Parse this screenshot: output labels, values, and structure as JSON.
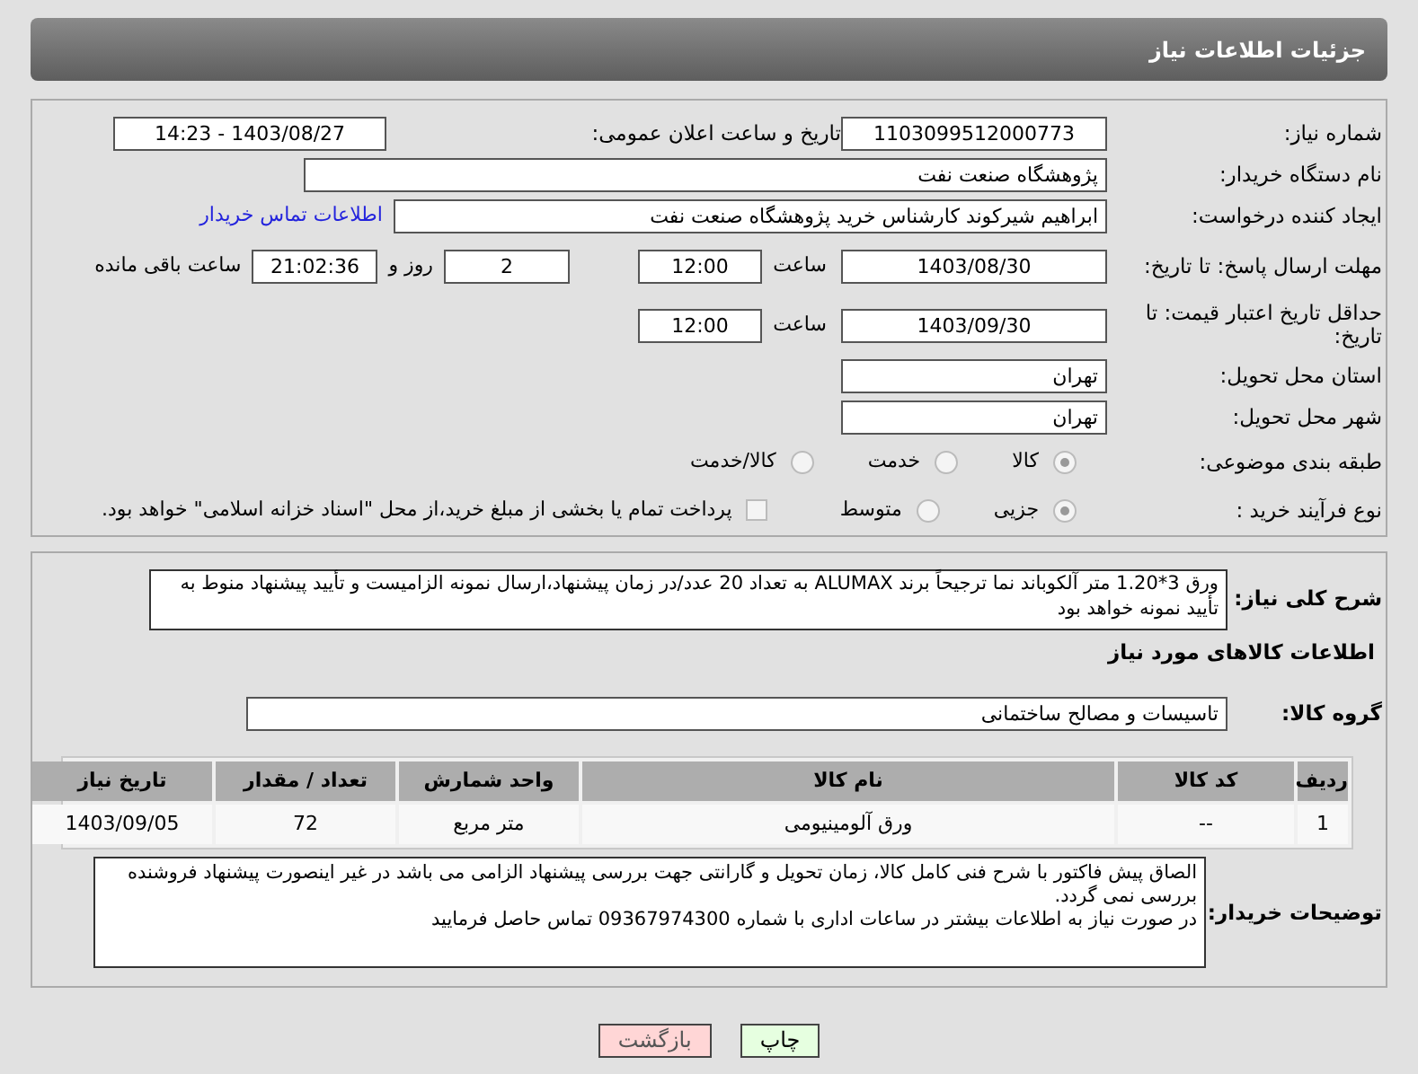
{
  "header": {
    "title": "جزئیات اطلاعات نیاز"
  },
  "need_number": {
    "label": "شماره نیاز:",
    "value": "1103099512000773"
  },
  "announce": {
    "label": "تاریخ و ساعت اعلان عمومی:",
    "value": "1403/08/27 - 14:23"
  },
  "buyer_org": {
    "label": "نام دستگاه خریدار:",
    "value": "پژوهشگاه صنعت نفت"
  },
  "requester": {
    "label": "ایجاد کننده درخواست:",
    "value": "ابراهیم شیرکوند کارشناس خرید پژوهشگاه صنعت نفت",
    "link": "اطلاعات تماس خریدار"
  },
  "reply_deadline": {
    "label": "مهلت ارسال پاسخ: تا تاریخ:",
    "date": "1403/08/30",
    "time_label": "ساعت",
    "time": "12:00",
    "days": "2",
    "days_label": "روز و",
    "remaining": "21:02:36",
    "remaining_label": "ساعت باقی مانده"
  },
  "price_validity": {
    "label": "حداقل تاریخ اعتبار قیمت: تا تاریخ:",
    "date": "1403/09/30",
    "time_label": "ساعت",
    "time": "12:00"
  },
  "province": {
    "label": "استان محل تحویل:",
    "value": "تهران"
  },
  "city": {
    "label": "شهر محل تحویل:",
    "value": "تهران"
  },
  "category": {
    "label": "طبقه بندی موضوعی:",
    "options": [
      {
        "label": "کالا",
        "selected": true
      },
      {
        "label": "خدمت",
        "selected": false
      },
      {
        "label": "کالا/خدمت",
        "selected": false
      }
    ]
  },
  "process": {
    "label": "نوع فرآیند خرید :",
    "options": [
      {
        "label": "جزیی",
        "selected": true
      },
      {
        "label": "متوسط",
        "selected": false
      }
    ],
    "treasury": {
      "checked": false,
      "label": "پرداخت تمام یا بخشی از مبلغ خرید،از محل \"اسناد خزانه اسلامی\" خواهد بود."
    }
  },
  "description": {
    "label": "شرح کلی نیاز:",
    "value": "ورق 3*1.20 متر آلکوباند نما ترجیحاً برند ALUMAX به تعداد 20 عدد/در زمان پیشنهاد،ارسال نمونه الزامیست و تأیید پیشنهاد منوط به تأیید نمونه خواهد بود"
  },
  "goods_heading": "اطلاعات کالاهای مورد نیاز",
  "goods_group": {
    "label": "گروه کالا:",
    "value": "تاسیسات و مصالح ساختمانی"
  },
  "table": {
    "columns": [
      "ردیف",
      "کد کالا",
      "نام کالا",
      "واحد شمارش",
      "تعداد / مقدار",
      "تاریخ نیاز"
    ],
    "rows": [
      [
        "1",
        "--",
        "ورق آلومینیومی",
        "متر مربع",
        "72",
        "1403/09/05"
      ]
    ]
  },
  "buyer_notes": {
    "label": "توضیحات خریدار:",
    "lines": [
      "الصاق پیش فاکتور با شرح فنی کامل کالا، زمان تحویل و گارانتی جهت بررسی پیشنهاد الزامی می باشد در غیر اینصورت پیشنهاد فروشنده بررسی نمی گردد.",
      "در صورت نیاز به اطلاعات بیشتر در ساعات اداری با شماره 09367974300 تماس حاصل فرمایید"
    ]
  },
  "buttons": [
    {
      "kind": "print",
      "label": "چاپ"
    },
    {
      "kind": "back",
      "label": "بازگشت"
    }
  ]
}
